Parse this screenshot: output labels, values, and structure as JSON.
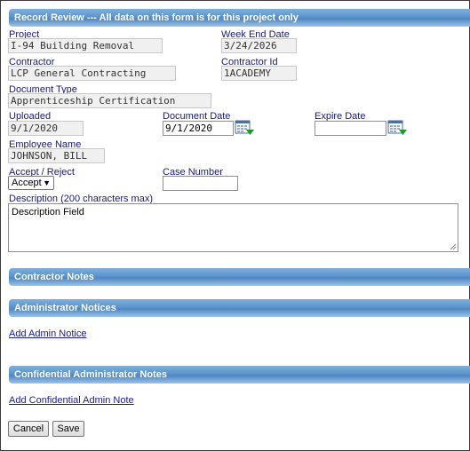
{
  "header": {
    "title": "Record Review --- All data on this form is for this project only"
  },
  "fields": {
    "project": {
      "label": "Project",
      "value": "I-94 Building Removal"
    },
    "week_end_date": {
      "label": "Week End Date",
      "value": "3/24/2026"
    },
    "contractor": {
      "label": "Contractor",
      "value": "LCP General Contracting"
    },
    "contractor_id": {
      "label": "Contractor Id",
      "value": "1ACADEMY"
    },
    "document_type": {
      "label": "Document Type",
      "value": "Apprenticeship Certification"
    },
    "uploaded": {
      "label": "Uploaded",
      "value": "9/1/2020"
    },
    "document_date": {
      "label": "Document Date",
      "value": "9/1/2020"
    },
    "expire_date": {
      "label": "Expire Date",
      "value": ""
    },
    "employee_name": {
      "label": "Employee Name",
      "value": "JOHNSON, BILL"
    },
    "accept_reject": {
      "label": "Accept / Reject",
      "value": "Accept"
    },
    "case_number": {
      "label": "Case Number",
      "value": ""
    },
    "description": {
      "label": "Description (200 characters max)",
      "value": "Description Field"
    }
  },
  "sections": {
    "contractor_notes": "Contractor Notes",
    "admin_notices": "Administrator Notices",
    "add_admin_notice": "Add Admin Notice",
    "confidential_notes": "Confidential Administrator Notes",
    "add_confidential_note": "Add Confidential Admin Note"
  },
  "buttons": {
    "cancel": "Cancel",
    "save": "Save"
  },
  "icons": {
    "calendar": "calendar-icon",
    "dropdown": "chevron-down-icon",
    "resize": "resize-grip-icon"
  },
  "colors": {
    "header_blue": "#5b93cc",
    "label_navy": "#1a1a7a"
  }
}
